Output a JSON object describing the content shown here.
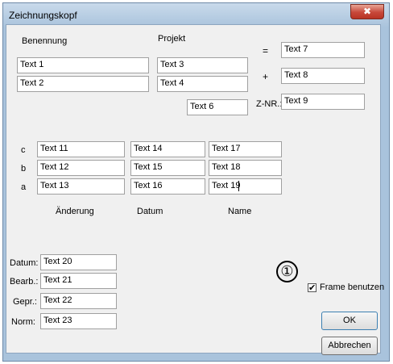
{
  "window": {
    "title": "Zeichnungskopf",
    "close_symbol": "✖"
  },
  "headers": {
    "benennung": "Benennung",
    "projekt": "Projekt"
  },
  "fields": {
    "text1": "Text 1",
    "text2": "Text 2",
    "text3": "Text 3",
    "text4": "Text 4",
    "text6": "Text 6",
    "text7": "Text 7",
    "text8": "Text 8",
    "text9": "Text 9",
    "text11": "Text 11",
    "text12": "Text 12",
    "text13": "Text 13",
    "text14": "Text 14",
    "text15": "Text 15",
    "text16": "Text 16",
    "text17": "Text 17",
    "text18": "Text 18",
    "text19": "Text 19",
    "text20": "Text 20",
    "text21": "Text 21",
    "text22": "Text 22",
    "text23": "Text 23"
  },
  "symbols": {
    "equals": "=",
    "plus": "+",
    "znr": "Z-NR.:"
  },
  "rows": {
    "c": "c",
    "b": "b",
    "a": "a"
  },
  "columns": {
    "aenderung": "Änderung",
    "datum": "Datum",
    "name": "Name"
  },
  "labels": {
    "datum": "Datum:",
    "bearb": "Bearb.:",
    "gepr": "Gepr.:",
    "norm": "Norm:"
  },
  "annotation": "①",
  "checkbox": {
    "label": "Frame benutzen",
    "checked": true,
    "mark": "✔"
  },
  "buttons": {
    "ok": "OK",
    "cancel": "Abbrechen"
  }
}
